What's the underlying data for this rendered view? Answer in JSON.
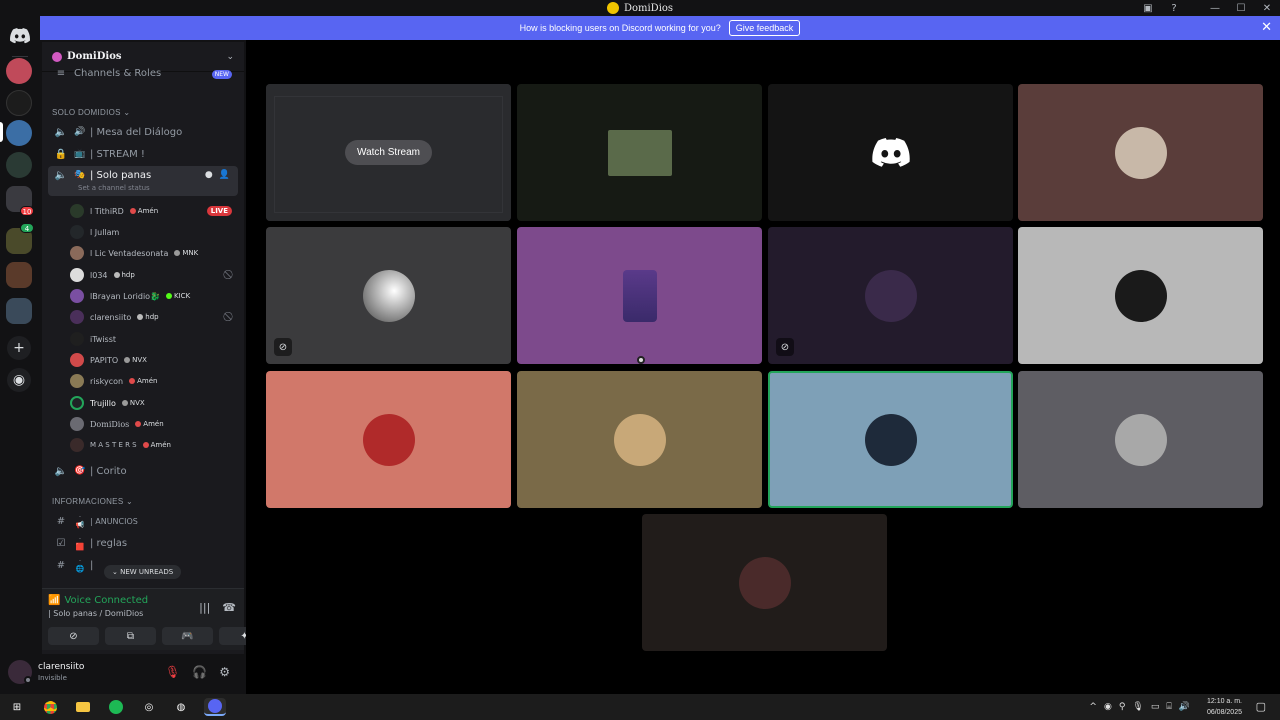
{
  "window": {
    "title": "DomiDios"
  },
  "banner": {
    "text": "How is blocking users on Discord working for you?",
    "button": "Give feedback"
  },
  "rail": {
    "badge_a": "10",
    "badge_b": "4"
  },
  "server": {
    "name": "DomiDios",
    "top_channel": "Channels & Roles",
    "top_badge": "NEW",
    "cat_solo": "SOLO DOMIDIOS",
    "channels": [
      {
        "label": "| Mesa del Diálogo"
      },
      {
        "label": "| STREAM !"
      },
      {
        "label": "| Solo panas",
        "status": "Set a channel status"
      },
      {
        "label": "| Corito"
      }
    ],
    "cat_info": "INFORMACIONES",
    "info_channels": [
      {
        "label": "| ANUNCIOS"
      },
      {
        "label": "| reglas"
      },
      {
        "label": "| "
      }
    ]
  },
  "voice_users": [
    {
      "name": "l TithiRD",
      "tag": "Amén",
      "live": "LIVE",
      "color": "#2a3a2a"
    },
    {
      "name": "l Jullam",
      "tag": "",
      "color": "#23272a"
    },
    {
      "name": "l Lic Ventadesonata",
      "tag": "MNK",
      "color": "#8a6a5a"
    },
    {
      "name": "l034",
      "tag": "hdp",
      "color": "#dcdcdc"
    },
    {
      "name": "lBrayan Loridio🐉 ",
      "tag": "KICK",
      "color": "#7a4fa2"
    },
    {
      "name": "clarensiito",
      "tag": "hdp",
      "color": "#4a2f5a"
    },
    {
      "name": "iTwisst",
      "tag": "",
      "color": "#1f1f1f"
    },
    {
      "name": "PAPITO",
      "tag": "NVX",
      "color": "#d14a4a"
    },
    {
      "name": "riskycon",
      "tag": "Amén",
      "color": "#8a7a55"
    },
    {
      "name": "Trujillo",
      "tag": "NVX",
      "color": "#202226"
    },
    {
      "name": "DomiDios",
      "tag": "Amén",
      "color": "#6a6a72"
    },
    {
      "name": "M A S T E R S",
      "tag": "Amén",
      "color": "#3a2a2a"
    }
  ],
  "new_unreads": "NEW UNREADS",
  "voice_panel": {
    "title": "Voice Connected",
    "subtitle": "| Solo panas / DomiDios"
  },
  "user": {
    "name": "clarensiito",
    "status": "Invisible"
  },
  "stage": {
    "watch_stream": "Watch Stream"
  },
  "taskbar": {
    "time": "12:10 a. m.",
    "date": "06/08/2025"
  },
  "colors": {
    "accent": "#5865f2",
    "speaking": "#23a55a",
    "live": "#da373c",
    "tile_colors": [
      "#2a2b2e",
      "#161a14",
      "#141414",
      "#5a3d3a",
      "#3b3b3d",
      "#7d4a8c",
      "#231b2c",
      "#b8b8b8",
      "#d1786a",
      "#7a6a48",
      "#7ea0b7",
      "#5e5d63",
      "#211c1a"
    ]
  }
}
